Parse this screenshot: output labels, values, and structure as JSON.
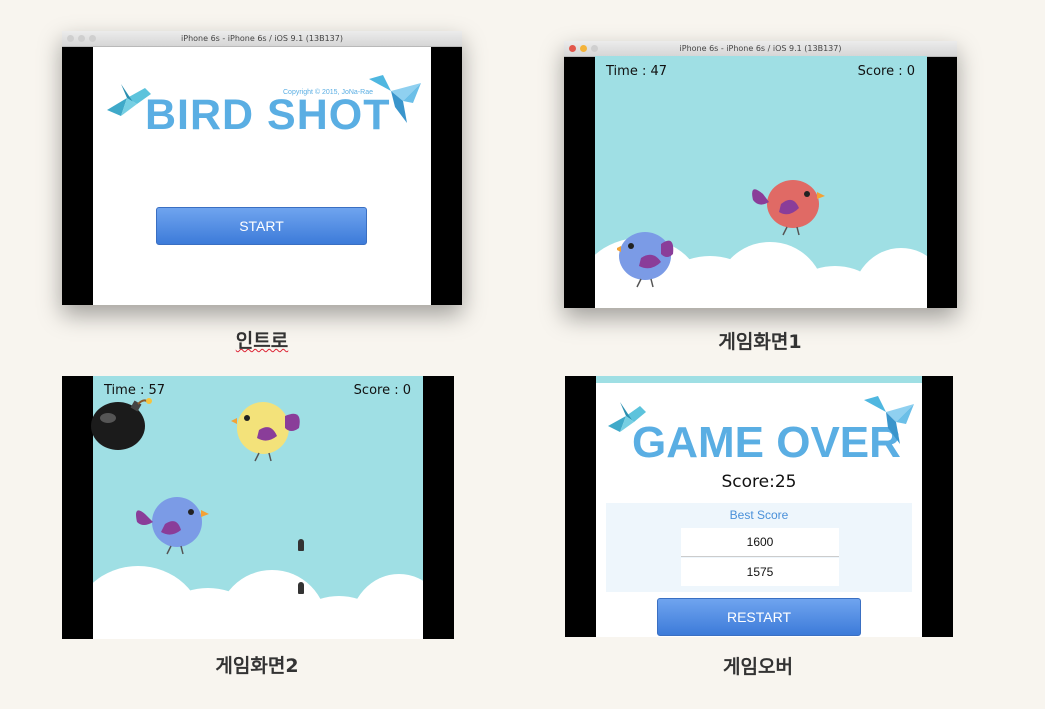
{
  "simulator": {
    "window_title_1": "iPhone 6s - iPhone 6s / iOS 9.1 (13B137)",
    "window_title_2": "iPhone 6s - iPhone 6s / iOS 9.1 (13B137)"
  },
  "intro": {
    "logo": "BIRD SHOT",
    "copyright": "Copyright © 2015, JoNa-Rae",
    "start_label": "START",
    "caption": "인트로"
  },
  "game1": {
    "time": "Time : 47",
    "score": "Score : 0",
    "caption": "게임화면1"
  },
  "game2": {
    "time": "Time : 57",
    "score": "Score : 0",
    "caption": "게임화면2"
  },
  "gameover": {
    "title": "GAME OVER",
    "score": "Score:25",
    "best_label": "Best Score",
    "best_scores": [
      "1600",
      "1575"
    ],
    "restart_label": "RESTART",
    "caption": "게임오버"
  },
  "colors": {
    "sky": "#9fdfe4",
    "logo": "#5aaee3",
    "button": "#4a86de"
  }
}
